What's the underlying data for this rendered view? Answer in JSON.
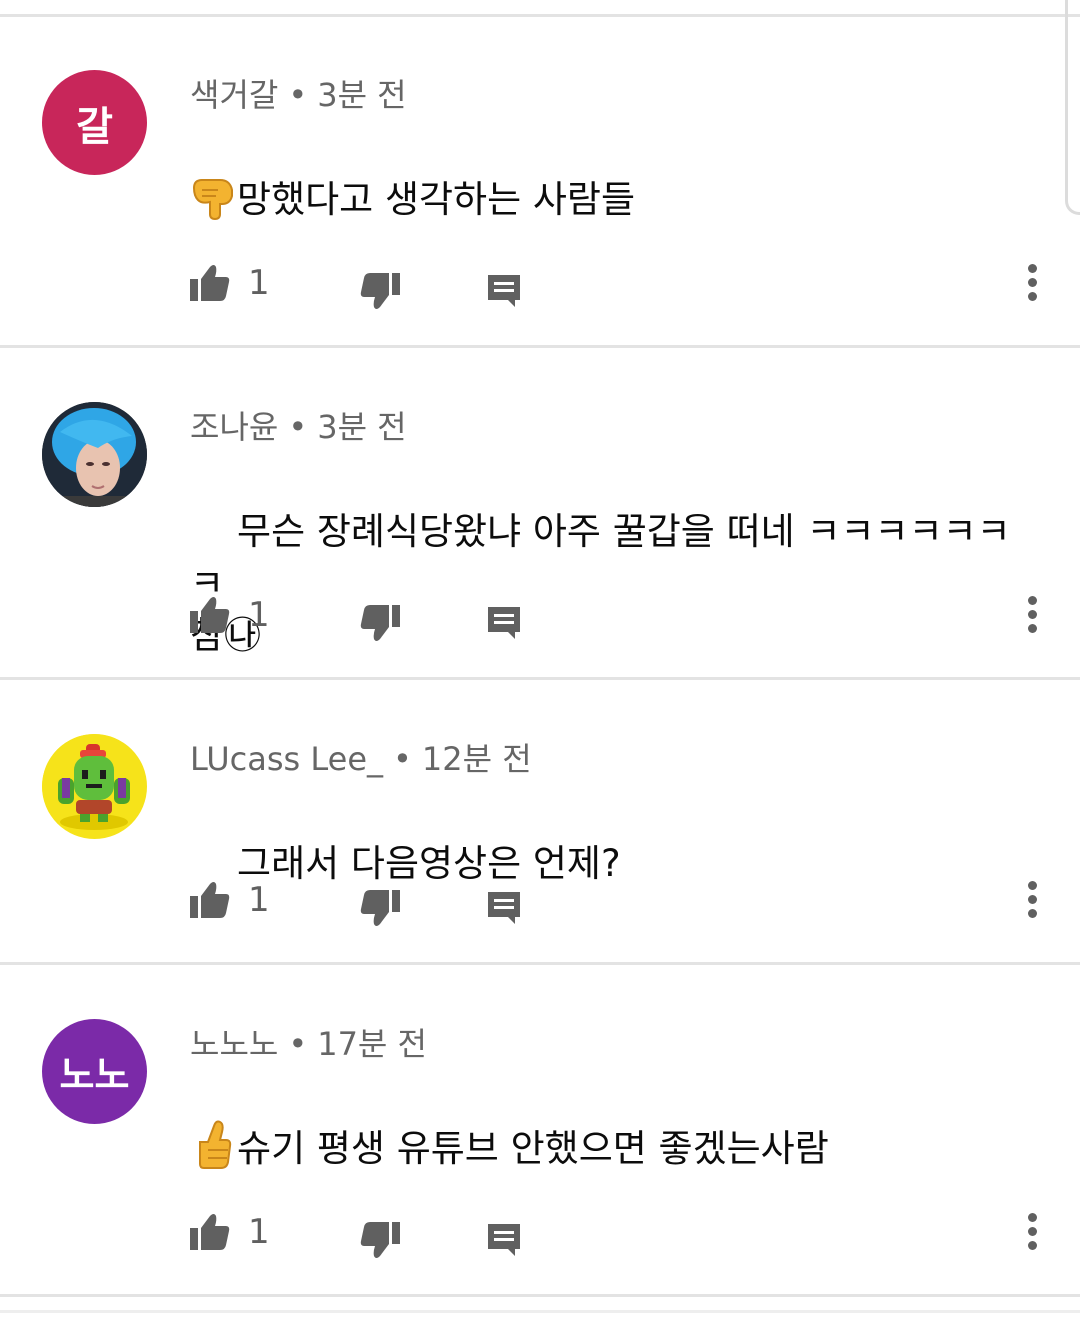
{
  "colors": {
    "avatar_1": "#c8265a",
    "avatar_4": "#7b2aa8",
    "meta_text": "#666666",
    "body_text": "#0c0c0c",
    "icon": "#606060",
    "divider": "#e3e3e3"
  },
  "comments": [
    {
      "avatar_text": "갈",
      "author": "색거갈",
      "time": "3분 전",
      "text": "망했다고 생각하는 사람들",
      "emoji": "backhand-index-pointing-down",
      "likes": "1"
    },
    {
      "avatar_text": "",
      "author": "조나윤",
      "time": "3분 전",
      "text": "무슨 장례식당왔냐 아주 꿀갑을 떠네 ㅋㅋㅋㅋㅋㅋㅋ\n참㉯",
      "emoji": "",
      "likes": "1"
    },
    {
      "avatar_text": "",
      "author": "LUcass Lee_",
      "time": "12분 전",
      "text": "그래서 다음영상은 언제?",
      "emoji": "",
      "likes": "1"
    },
    {
      "avatar_text": "노노",
      "author": "노노노",
      "time": "17분 전",
      "text": "슈기 평생 유튜브 안했으면 좋겠는사람",
      "emoji": "thumbs-up",
      "likes": "1"
    }
  ]
}
